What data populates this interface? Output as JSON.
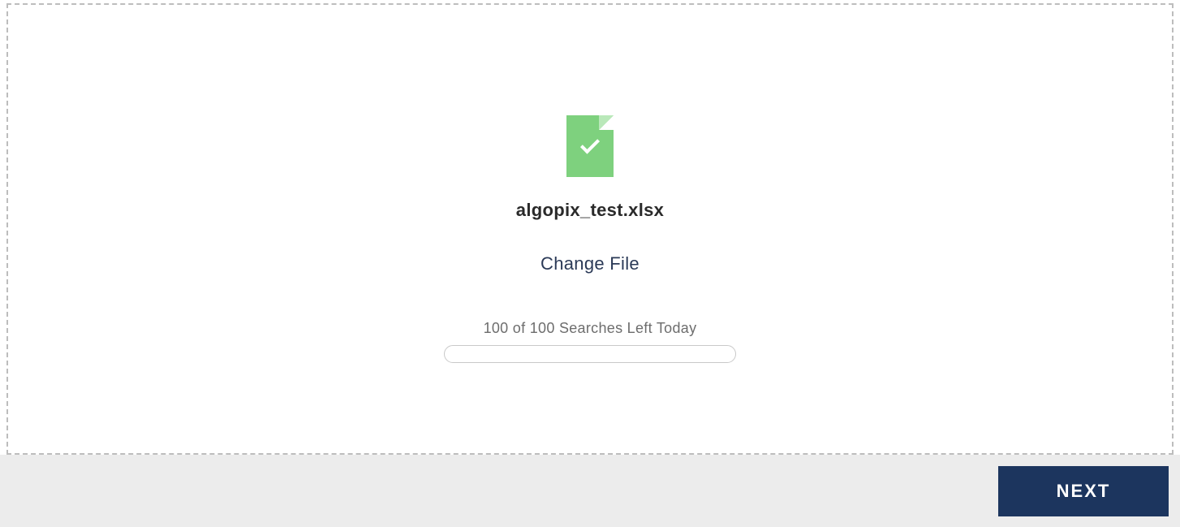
{
  "upload": {
    "filename": "algopix_test.xlsx",
    "change_label": "Change File",
    "quota_text": "100 of 100 Searches Left Today"
  },
  "footer": {
    "next_label": "NEXT"
  }
}
